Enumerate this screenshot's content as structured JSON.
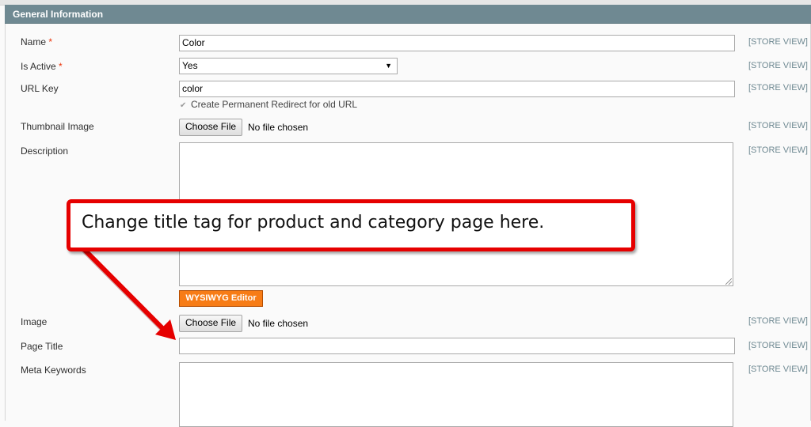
{
  "fieldset": {
    "title": "General Information"
  },
  "scope_label": "[STORE VIEW]",
  "fields": {
    "name": {
      "label": "Name",
      "required": "*",
      "value": "Color"
    },
    "is_active": {
      "label": "Is Active",
      "required": "*",
      "value": "Yes"
    },
    "url_key": {
      "label": "URL Key",
      "value": "color",
      "redirect_label": "Create Permanent Redirect for old URL"
    },
    "thumbnail": {
      "label": "Thumbnail Image",
      "button": "Choose File",
      "status": "No file chosen"
    },
    "description": {
      "label": "Description",
      "value": "",
      "editor_button": "WYSIWYG Editor"
    },
    "image": {
      "label": "Image",
      "button": "Choose File",
      "status": "No file chosen"
    },
    "page_title": {
      "label": "Page Title",
      "value": ""
    },
    "meta_keywords": {
      "label": "Meta Keywords",
      "value": ""
    }
  },
  "annotation": {
    "text": "Change title tag for product and category page here.",
    "color": "#e60000"
  },
  "colors": {
    "header": "#6f8992",
    "required": "#eb340a",
    "wysiwyg": "#f77c16"
  }
}
